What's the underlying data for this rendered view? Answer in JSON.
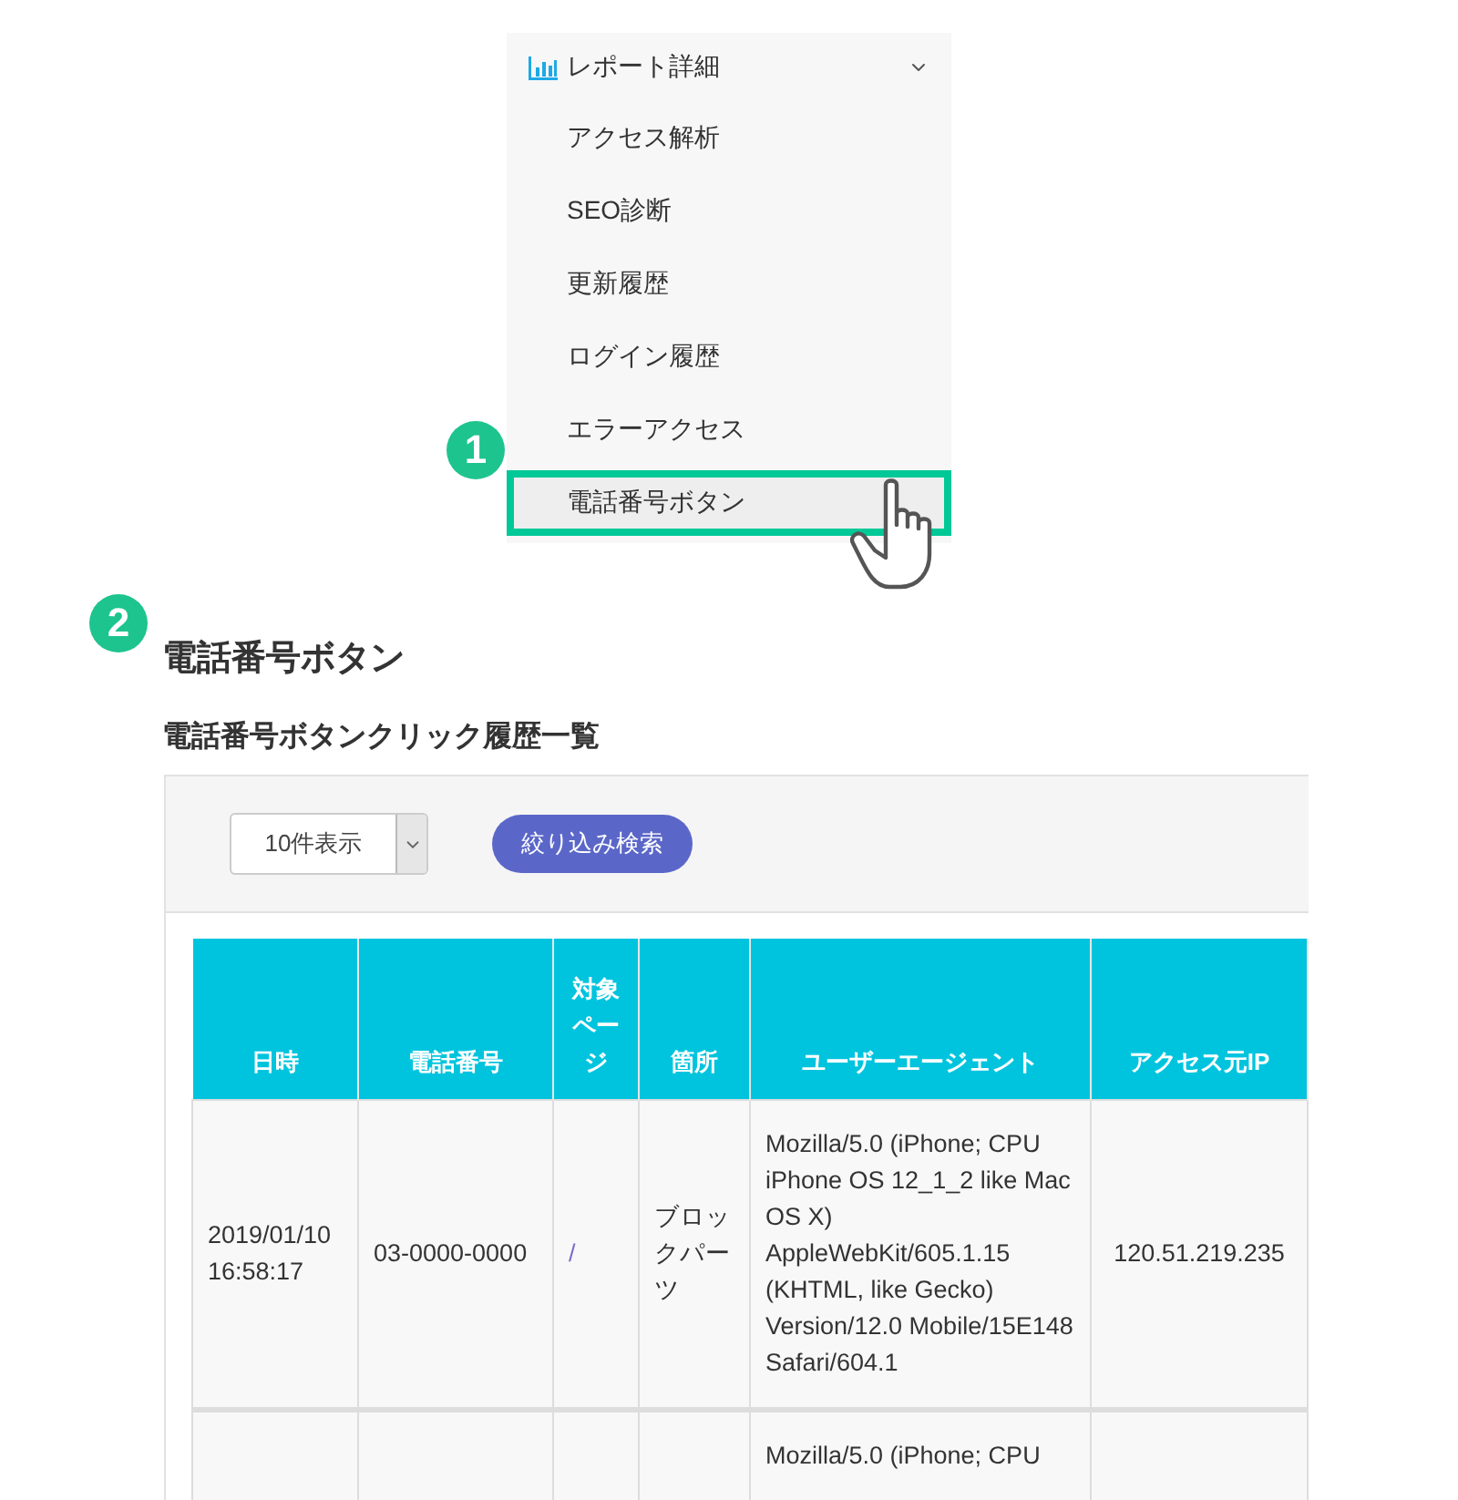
{
  "menu": {
    "header": {
      "label": "レポート詳細",
      "expanded": true
    },
    "items": [
      {
        "label": "アクセス解析",
        "selected": false
      },
      {
        "label": "SEO診断",
        "selected": false
      },
      {
        "label": "更新履歴",
        "selected": false
      },
      {
        "label": "ログイン履歴",
        "selected": false
      },
      {
        "label": "エラーアクセス",
        "selected": false
      },
      {
        "label": "電話番号ボタン",
        "selected": true
      }
    ]
  },
  "step_badges": [
    {
      "number": "1"
    },
    {
      "number": "2"
    }
  ],
  "page": {
    "title": "電話番号ボタン",
    "subtitle": "電話番号ボタンクリック履歴一覧"
  },
  "toolbar": {
    "per_page": "10件表示",
    "filter_button": "絞り込み検索"
  },
  "table": {
    "columns": [
      "日時",
      "電話番号",
      "対象ページ",
      "箇所",
      "ユーザーエージェント",
      "アクセス元IP"
    ],
    "rows": [
      {
        "date": "2019/01/10 16:58:17",
        "phone": "03-0000-0000",
        "page": "/",
        "place": "ブロックパーツ",
        "user_agent": "Mozilla/5.0 (iPhone; CPU iPhone OS 12_1_2 like Mac OS X) AppleWebKit/605.1.15 (KHTML, like Gecko) Version/12.0 Mobile/15E148 Safari/604.1",
        "ip": "120.51.219.235"
      },
      {
        "user_agent": "Mozilla/5.0 (iPhone; CPU"
      }
    ]
  }
}
